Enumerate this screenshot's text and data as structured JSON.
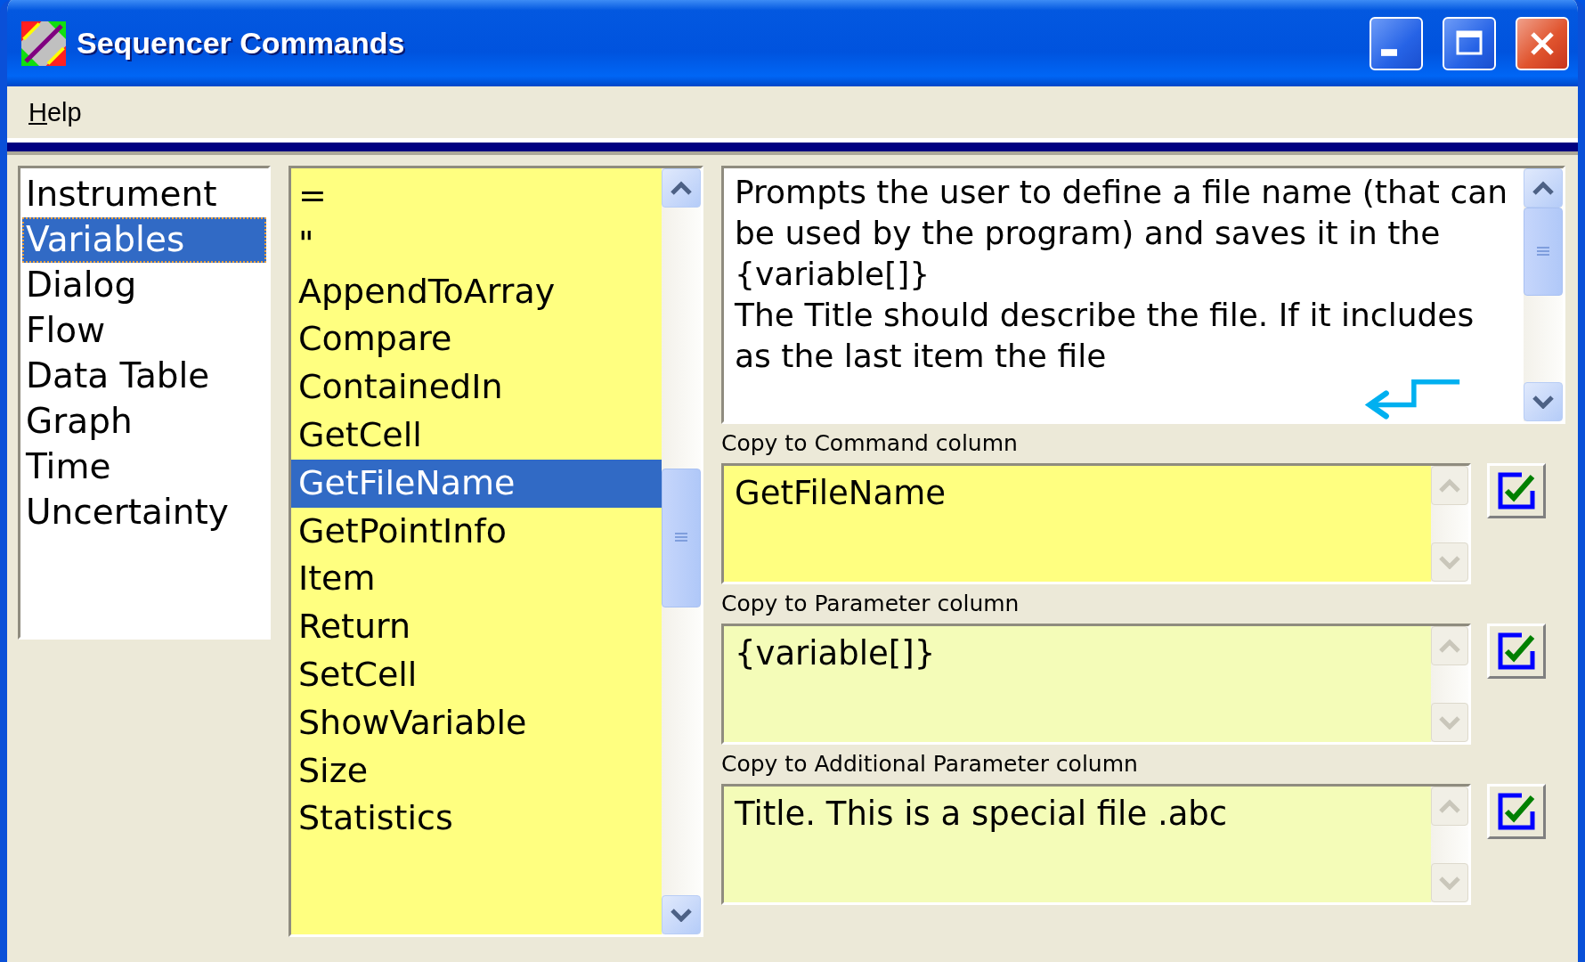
{
  "window": {
    "title": "Sequencer Commands"
  },
  "menu": [
    {
      "label": "Help"
    }
  ],
  "categories": [
    {
      "label": "Instrument",
      "selected": false
    },
    {
      "label": "Variables",
      "selected": true
    },
    {
      "label": "Dialog",
      "selected": false
    },
    {
      "label": "Flow",
      "selected": false
    },
    {
      "label": "Data Table",
      "selected": false
    },
    {
      "label": "Graph",
      "selected": false
    },
    {
      "label": "Time",
      "selected": false
    },
    {
      "label": "Uncertainty",
      "selected": false
    }
  ],
  "commands": [
    {
      "label": "=",
      "selected": false
    },
    {
      "label": "\"",
      "selected": false
    },
    {
      "label": "AppendToArray",
      "selected": false
    },
    {
      "label": "Compare",
      "selected": false
    },
    {
      "label": "ContainedIn",
      "selected": false
    },
    {
      "label": "GetCell",
      "selected": false
    },
    {
      "label": "GetFileName",
      "selected": true
    },
    {
      "label": "GetPointInfo",
      "selected": false
    },
    {
      "label": "Item",
      "selected": false
    },
    {
      "label": "Return",
      "selected": false
    },
    {
      "label": "SetCell",
      "selected": false
    },
    {
      "label": "ShowVariable",
      "selected": false
    },
    {
      "label": "Size",
      "selected": false
    },
    {
      "label": "Statistics",
      "selected": false
    }
  ],
  "description": [
    "Prompts the user to define a file name (that can be used by the program) and saves it in the {variable[]}",
    "The Title should describe the file. If it includes as the last item the file"
  ],
  "copy_fields": [
    {
      "label": "Copy to Command column",
      "value": "GetFileName",
      "focused": true,
      "checked": true
    },
    {
      "label": "Copy to Parameter column",
      "value": "{variable[]}",
      "focused": false,
      "checked": true
    },
    {
      "label": "Copy to Additional Parameter column",
      "value": "Title. This is a special file .abc",
      "focused": false,
      "checked": true
    }
  ]
}
